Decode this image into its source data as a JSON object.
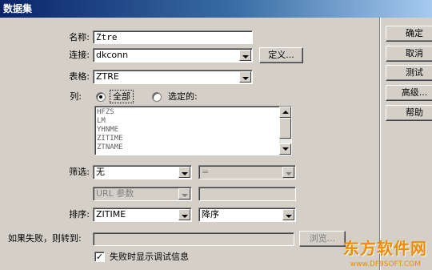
{
  "window": {
    "title": "数据集"
  },
  "form": {
    "name_label": "名称:",
    "name_value": "Ztre",
    "connection_label": "连接:",
    "connection_value": "dkconn",
    "define_button": "定义...",
    "table_label": "表格:",
    "table_value": "ZTRE",
    "columns_label": "列:",
    "columns_all": "全部",
    "columns_selected": "选定的:",
    "columns_list": [
      "HFZS",
      "LM",
      "YHNME",
      "ZITIME",
      "ZTNAME"
    ],
    "filter_label": "筛选:",
    "filter_value": "无",
    "filter_operator": "=",
    "filter_param_value": "URL 参数",
    "sort_label": "排序:",
    "sort_field": "ZITIME",
    "sort_order": "降序",
    "on_fail_label": "如果失败，则转到:",
    "browse_button": "浏览...",
    "debug_checkbox_label": "失败时显示调试信息",
    "debug_checked": true
  },
  "side_buttons": {
    "ok": "确定",
    "cancel": "取消",
    "test": "测试",
    "advanced": "高级...",
    "help": "帮助"
  },
  "watermark": {
    "title": "东方软件网",
    "url": "www.DF9SOFT.COM"
  }
}
